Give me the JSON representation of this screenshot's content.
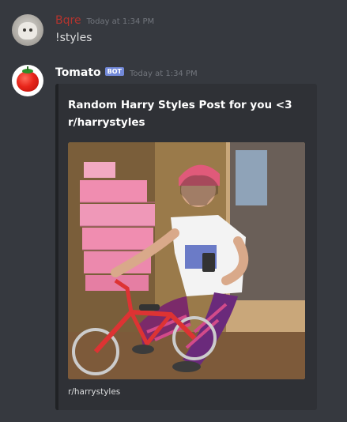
{
  "messages": [
    {
      "username": "Bqre",
      "timestamp": "Today at 1:34 PM",
      "text": "!styles",
      "avatar_icon": "user-avatar-icon"
    },
    {
      "username": "Tomato",
      "bot_tag": "BOT",
      "timestamp": "Today at 1:34 PM",
      "avatar_icon": "tomato-avatar-icon",
      "embed": {
        "title": "Random Harry Styles Post for you <3 r/harrystyles",
        "footer": "r/harrystyles",
        "image_icon": "photo-image"
      }
    }
  ],
  "colors": {
    "background": "#36393f",
    "embed_background": "#2f3136",
    "username_bqre": "#b3342e",
    "bot_tag": "#7289da",
    "timestamp": "#72767d"
  }
}
